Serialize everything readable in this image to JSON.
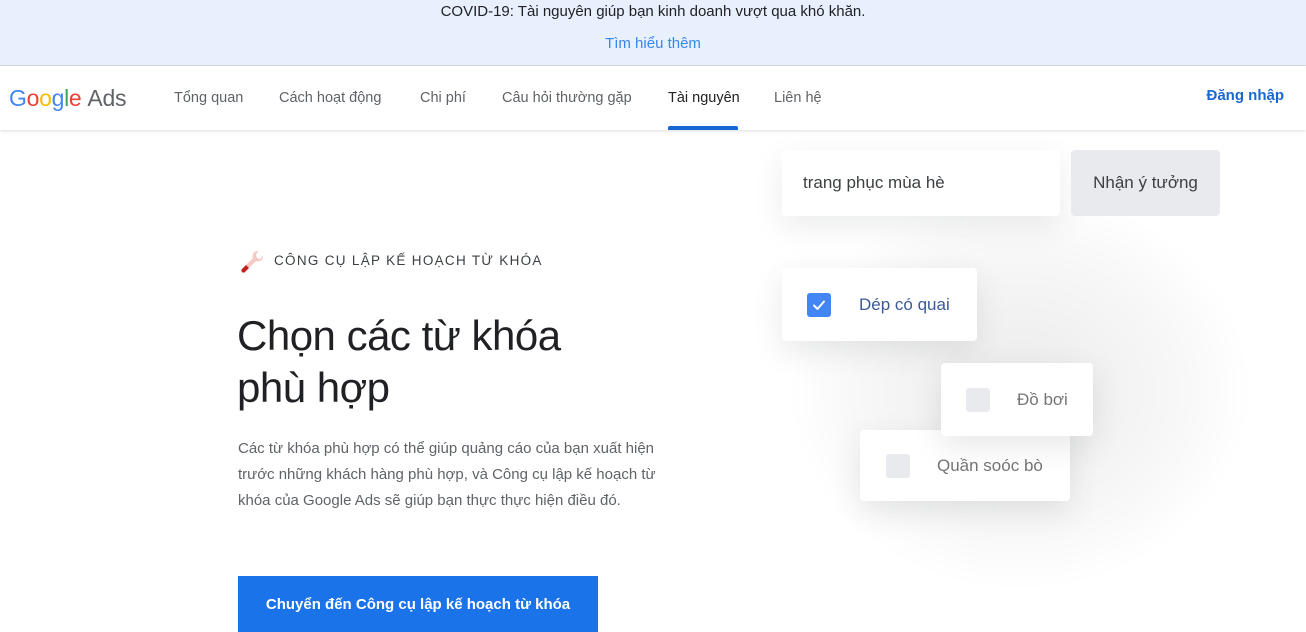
{
  "banner": {
    "text": "COVID-19: Tài nguyên giúp bạn kinh doanh vượt qua khó khăn.",
    "link": "Tìm hiểu thêm"
  },
  "header": {
    "logo": {
      "letters": [
        "G",
        "o",
        "o",
        "g",
        "l",
        "e"
      ],
      "product": "Ads"
    },
    "nav": [
      {
        "label": "Tổng quan",
        "active": false
      },
      {
        "label": "Cách hoạt động",
        "active": false
      },
      {
        "label": "Chi phí",
        "active": false
      },
      {
        "label": "Câu hỏi thường gặp",
        "active": false
      },
      {
        "label": "Tài nguyên",
        "active": true
      },
      {
        "label": "Liên hệ",
        "active": false
      }
    ],
    "signin_label": "Đăng nhập"
  },
  "hero": {
    "eyebrow_icon": "wrench-icon",
    "eyebrow": "CÔNG CỤ LẬP KẾ HOẠCH TỪ KHÓA",
    "headline_line1": "Chọn các từ khóa",
    "headline_line2": "phù hợp",
    "description": "Các từ khóa phù hợp có thể giúp quảng cáo của bạn xuất hiện trước những khách hàng phù hợp, và Công cụ lập kế hoạch từ khóa của Google Ads sẽ giúp bạn thực thực hiện điều đó.",
    "cta_label": "Chuyển đến Công cụ lập kế hoạch từ khóa"
  },
  "illustration": {
    "search_value": "trang phục mùa hè",
    "ideas_button": "Nhận ý tưởng",
    "keywords": [
      {
        "label": "Dép có quai",
        "checked": true
      },
      {
        "label": "Đồ bơi",
        "checked": false
      },
      {
        "label": "Quần soóc bò",
        "checked": false
      }
    ]
  },
  "colors": {
    "primary": "#1a73e8",
    "nav_active_underline": "#1967d2",
    "banner_bg": "#e8f0fe",
    "checkbox_checked": "#4285f4"
  }
}
